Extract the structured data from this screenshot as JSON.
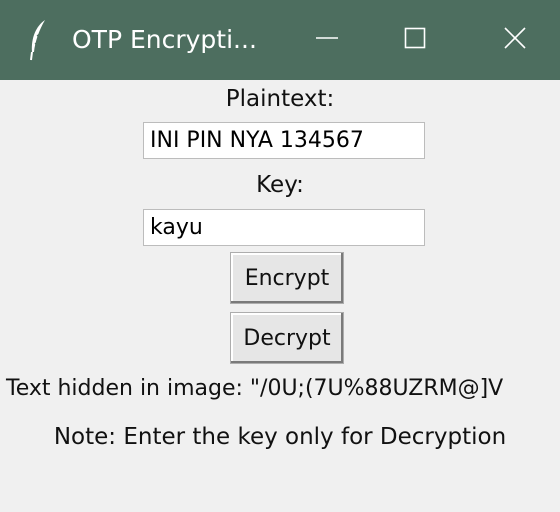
{
  "window": {
    "title": "OTP Encrypti...",
    "controls": {
      "minimize_icon": "minimize-icon",
      "maximize_icon": "maximize-icon",
      "close_icon": "close-icon"
    },
    "title_bar_color": "#4d6e5f",
    "app_icon": "feather-icon"
  },
  "form": {
    "plaintext_label": "Plaintext:",
    "plaintext_value": "INI PIN NYA 134567",
    "key_label": "Key:",
    "key_value": "kayu",
    "encrypt_label": "Encrypt",
    "decrypt_label": "Decrypt",
    "hidden_text": "Text hidden in image: \"/0U;(7U%88UZRM@]V",
    "note": "Note: Enter the key only for Decryption"
  }
}
